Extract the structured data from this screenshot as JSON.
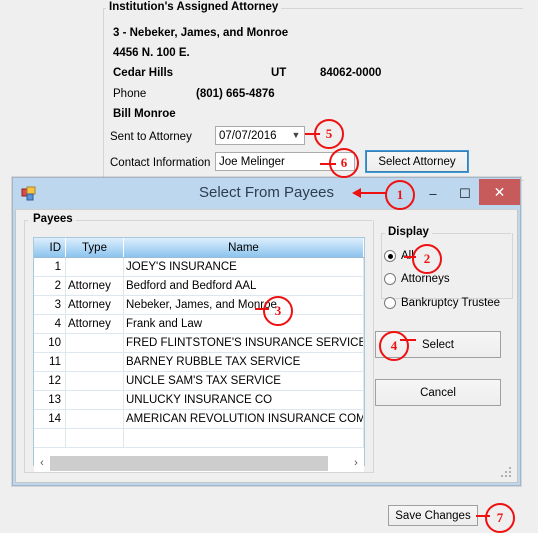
{
  "background_form": {
    "groupbox_title": "Institution's Assigned Attorney",
    "attorney_name": "3 - Nebeker, James, and Monroe",
    "address_street": "4456 N. 100 E.",
    "city": "Cedar Hills",
    "state": "UT",
    "zip": "84062-0000",
    "phone_label": "Phone",
    "phone_value": "(801) 665-4876",
    "contact_name": "Bill Monroe",
    "sent_to_attorney_label": "Sent to Attorney",
    "sent_to_attorney_value": "07/07/2016",
    "contact_information_label": "Contact Information",
    "contact_information_value": "Joe Melinger",
    "select_attorney_button": "Select Attorney",
    "save_changes_button": "Save Changes"
  },
  "dialog": {
    "title": "Select From Payees",
    "icon": "window-app-icon",
    "minimize": "–",
    "maximize": "☐",
    "close": "✕",
    "payees_group_title": "Payees",
    "display_group_title": "Display",
    "grid": {
      "columns": [
        "ID",
        "Type",
        "Name"
      ],
      "rows": [
        {
          "id": "1",
          "type": "",
          "name": "JOEY'S INSURANCE"
        },
        {
          "id": "2",
          "type": "Attorney",
          "name": "Bedford and Bedford AAL"
        },
        {
          "id": "3",
          "type": "Attorney",
          "name": "Nebeker, James, and Monroe"
        },
        {
          "id": "4",
          "type": "Attorney",
          "name": "Frank and Law"
        },
        {
          "id": "10",
          "type": "",
          "name": "FRED FLINTSTONE'S INSURANCE SERVICES"
        },
        {
          "id": "11",
          "type": "",
          "name": "BARNEY RUBBLE TAX SERVICE"
        },
        {
          "id": "12",
          "type": "",
          "name": "UNCLE SAM'S TAX SERVICE"
        },
        {
          "id": "13",
          "type": "",
          "name": "UNLUCKY INSURANCE CO"
        },
        {
          "id": "14",
          "type": "",
          "name": "AMERICAN REVOLUTION INSURANCE COMPANY"
        },
        {
          "id": "",
          "type": "",
          "name": ""
        }
      ]
    },
    "display_options": [
      {
        "label": "All",
        "selected": true
      },
      {
        "label": "Attorneys",
        "selected": false
      },
      {
        "label": "Bankruptcy Trustee",
        "selected": false
      }
    ],
    "select_button": "Select",
    "cancel_button": "Cancel",
    "scroll_left_icon": "‹",
    "scroll_right_icon": "›"
  },
  "annotations": [
    {
      "number": "1",
      "target": "dialog-title"
    },
    {
      "number": "2",
      "target": "radio-all"
    },
    {
      "number": "3",
      "target": "grid-row-nebeker"
    },
    {
      "number": "4",
      "target": "select-button"
    },
    {
      "number": "5",
      "target": "sent-to-attorney-combo"
    },
    {
      "number": "6",
      "target": "contact-information-field"
    },
    {
      "number": "7",
      "target": "save-changes-button"
    }
  ],
  "colors": {
    "annotation": "#ee1111",
    "titlebar": "#bdd7ee",
    "close_button": "#c75a5a",
    "page_background": "#efefef",
    "grid_header_top": "#ddeefc",
    "grid_header_bottom": "#8cc4ee"
  }
}
